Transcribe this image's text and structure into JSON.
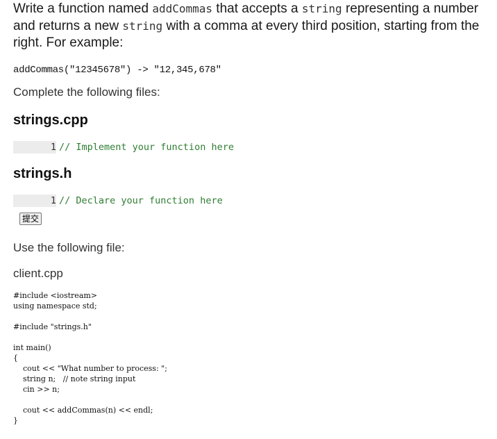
{
  "prompt": {
    "part1": "Write a function named ",
    "func_name": "addCommas",
    "part2": " that accepts a ",
    "type1": "string",
    "part3": " representing a number and returns a new ",
    "type2": "string",
    "part4": " with a comma at every third position, starting from the right. For example:"
  },
  "example": "addCommas(\"12345678\") -> \"12,345,678\"",
  "complete_label": "Complete the following files:",
  "files": [
    {
      "name": "strings.cpp",
      "line_number": "1",
      "code": "// Implement your function here"
    },
    {
      "name": "strings.h",
      "line_number": "1",
      "code": "// Declare your function here"
    }
  ],
  "submit_label": "提交",
  "use_label": "Use the following file:",
  "client": {
    "name": "client.cpp",
    "code": "#include <iostream>\nusing namespace std;\n\n#include \"strings.h\"\n\nint main()\n{\n    cout << \"What number to process: \";\n    string n;   // note string input\n    cin >> n;\n\n    cout << addCommas(n) << endl;\n}"
  }
}
